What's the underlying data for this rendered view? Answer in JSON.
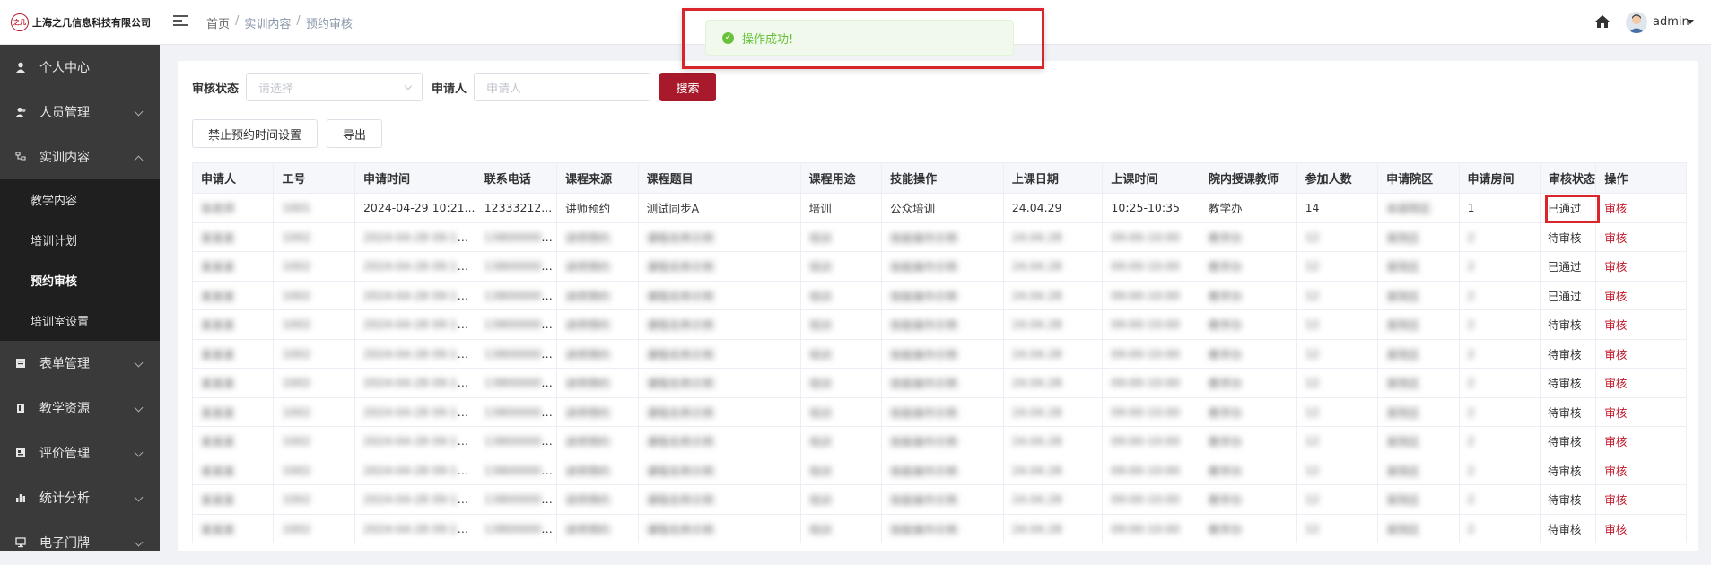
{
  "header": {
    "company": "上海之几信息科技有限公司",
    "logo_mark": "之几",
    "breadcrumb": [
      "首页",
      "实训内容",
      "预约审核"
    ],
    "username": "admin"
  },
  "toast": {
    "message": "操作成功!"
  },
  "sidebar": {
    "items": [
      {
        "label": "个人中心",
        "icon": "user-icon"
      },
      {
        "label": "人员管理",
        "icon": "users-icon"
      },
      {
        "label": "实训内容",
        "icon": "tree-icon",
        "expanded": true,
        "children": [
          "教学内容",
          "培训计划",
          "预约审核",
          "培训室设置"
        ],
        "active_child": "预约审核"
      },
      {
        "label": "表单管理",
        "icon": "form-icon"
      },
      {
        "label": "教学资源",
        "icon": "book-icon"
      },
      {
        "label": "评价管理",
        "icon": "rating-icon"
      },
      {
        "label": "统计分析",
        "icon": "chart-icon"
      },
      {
        "label": "电子门牌",
        "icon": "display-icon"
      }
    ]
  },
  "filters": {
    "status_label": "审核状态",
    "status_placeholder": "请选择",
    "applicant_label": "申请人",
    "applicant_placeholder": "申请人",
    "search_label": "搜索"
  },
  "actions": {
    "disable_time": "禁止预约时间设置",
    "export": "导出"
  },
  "table": {
    "columns": [
      "申请人",
      "工号",
      "申请时间",
      "联系电话",
      "课程来源",
      "课程题目",
      "课程用途",
      "技能操作",
      "上课日期",
      "上课时间",
      "院内授课教师",
      "参加人数",
      "申请院区",
      "申请房间",
      "审核状态",
      "操作"
    ],
    "first_row": {
      "applicant": "张老师",
      "job_no": "1001",
      "time": "2024-04-29 10:21...",
      "phone": "12333212...",
      "source": "讲师预约",
      "title": "测试同步A",
      "purpose": "培训",
      "skill": "公众培训",
      "date": "24.04.29",
      "class_time": "10:25-10:35",
      "teacher": "教学办",
      "count": "14",
      "campus": "本部院区",
      "room": "1",
      "status": "已通过",
      "op": "审核"
    },
    "row_statuses": [
      "待审核",
      "已通过",
      "已通过",
      "待审核",
      "待审核",
      "待审核",
      "待审核",
      "待审核",
      "待审核",
      "待审核",
      "待审核"
    ],
    "op_label": "审核",
    "blur_samples": [
      "某某某",
      "1002",
      "2024-04-28 09:12:33",
      "13800000000",
      "讲师预约",
      "课程名称示例",
      "培训",
      "技能操作示例",
      "24.04.28",
      "09:00-10:00",
      "教学办",
      "12",
      "某院区",
      "2"
    ]
  }
}
